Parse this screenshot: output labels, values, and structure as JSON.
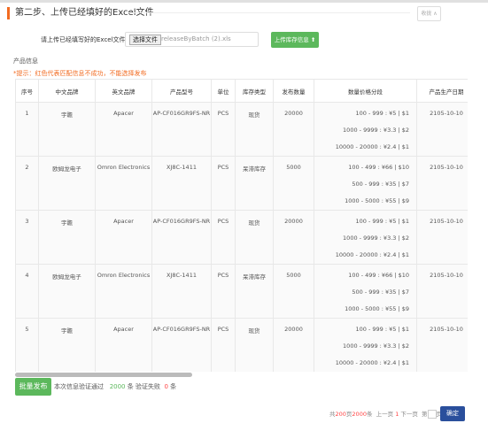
{
  "header": {
    "title": "第二步、上传已经填好的Excel文件",
    "collapse_label": "收拢 ∧"
  },
  "upload": {
    "label": "请上传已经填写好的Excel文件",
    "choose_label": "选择文件",
    "file_name": "releaseByBatch (2).xls",
    "upload_button": "上传库存信息"
  },
  "info": {
    "section_label": "产品信息",
    "hint": "*提示：红色代表匹配信息不成功，不能选择发布"
  },
  "table": {
    "columns": [
      "序号",
      "中文品牌",
      "英文品牌",
      "产品型号",
      "单位",
      "库存类型",
      "发布数量",
      "数量价格分段",
      "产品生产日期"
    ],
    "rows": [
      {
        "no": "1",
        "cn": "宇瞻",
        "en": "Apacer",
        "model": "AP-CF016GR9FS-NR",
        "unit": "PCS",
        "type": "现货",
        "qty": "20000",
        "prices": [
          "100 - 999 : ¥5 | $1",
          "1000 - 9999 : ¥3.3 | $2",
          "10000 - 20000 : ¥2.4 | $1"
        ],
        "date": "2105-10-10"
      },
      {
        "no": "2",
        "cn": "欧姆龙电子",
        "en": "Omron Electronics",
        "model": "XJ8C-1411",
        "unit": "PCS",
        "type": "呆滞库存",
        "qty": "5000",
        "prices": [
          "100 - 499 : ¥66 | $10",
          "500 - 999 : ¥35 | $7",
          "1000 - 5000 : ¥55 | $9"
        ],
        "date": "2105-10-10"
      },
      {
        "no": "3",
        "cn": "宇瞻",
        "en": "Apacer",
        "model": "AP-CF016GR9FS-NR",
        "unit": "PCS",
        "type": "现货",
        "qty": "20000",
        "prices": [
          "100 - 999 : ¥5 | $1",
          "1000 - 9999 : ¥3.3 | $2",
          "10000 - 20000 : ¥2.4 | $1"
        ],
        "date": "2105-10-10"
      },
      {
        "no": "4",
        "cn": "欧姆龙电子",
        "en": "Omron Electronics",
        "model": "XJ8C-1411",
        "unit": "PCS",
        "type": "呆滞库存",
        "qty": "5000",
        "prices": [
          "100 - 499 : ¥66 | $10",
          "500 - 999 : ¥35 | $7",
          "1000 - 5000 : ¥55 | $9"
        ],
        "date": "2105-10-10"
      },
      {
        "no": "5",
        "cn": "宇瞻",
        "en": "Apacer",
        "model": "AP-CF016GR9FS-NR",
        "unit": "PCS",
        "type": "现货",
        "qty": "20000",
        "prices": [
          "100 - 999 : ¥5 | $1",
          "1000 - 9999 : ¥3.3 | $2",
          "10000 - 20000 : ¥2.4 | $1"
        ],
        "date": "2105-10-10"
      }
    ]
  },
  "footer": {
    "batch_button": "批量发布",
    "verify_prefix": "本次信息验证通过",
    "pass_count": "2000",
    "verify_mid": "条 验证失败",
    "fail_count": "0",
    "verify_suffix": "条"
  },
  "pager": {
    "total_prefix": "共",
    "pages": "200",
    "mid": "页",
    "records": "2000",
    "suffix": "条",
    "prev": "上一页",
    "current": "1",
    "next": "下一页",
    "goto_prefix": "第",
    "goto_suffix": "页",
    "ok": "确定"
  },
  "colors": {
    "accent": "#f26b21",
    "green": "#5cb85c",
    "ok_button": "#2a4f9c"
  }
}
